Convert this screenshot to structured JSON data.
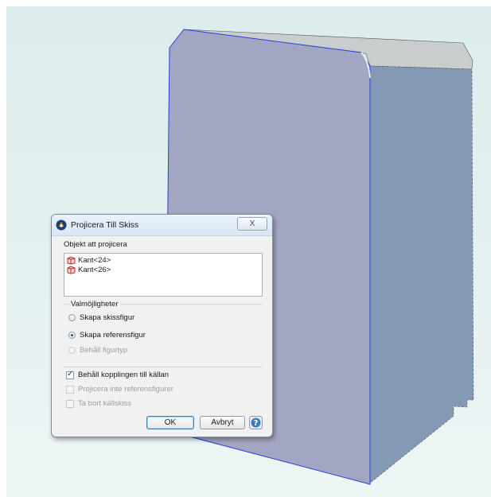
{
  "dialog": {
    "title": "Projicera Till Skiss",
    "close_label": "X",
    "objects_group_label": "Objekt att projicera",
    "objects": [
      {
        "label": "Kant<24>",
        "icon": "edge-cube-icon"
      },
      {
        "label": "Kant<26>",
        "icon": "edge-cube-icon"
      }
    ],
    "options_group_label": "Valmöjligheter",
    "radio_options": [
      {
        "label": "Skapa skissfigur",
        "checked": false,
        "enabled": true
      },
      {
        "label": "Skapa referensfigur",
        "checked": true,
        "enabled": true
      },
      {
        "label": "Behåll figurtyp",
        "checked": false,
        "enabled": false
      }
    ],
    "check_options": [
      {
        "label": "Behåll kopplingen till källan",
        "checked": true,
        "enabled": true
      },
      {
        "label": "Projicera inte referensfigurer",
        "checked": false,
        "enabled": false
      },
      {
        "label": "Ta bort källskiss",
        "checked": false,
        "enabled": false
      }
    ],
    "ok_label": "OK",
    "cancel_label": "Avbryt",
    "help_icon": "help-icon"
  },
  "colors": {
    "front_face": "#a3a6c2",
    "side_face": "#8499b3",
    "top_face": "#c9cdcd",
    "edge_highlight": "#2c3fe0"
  }
}
